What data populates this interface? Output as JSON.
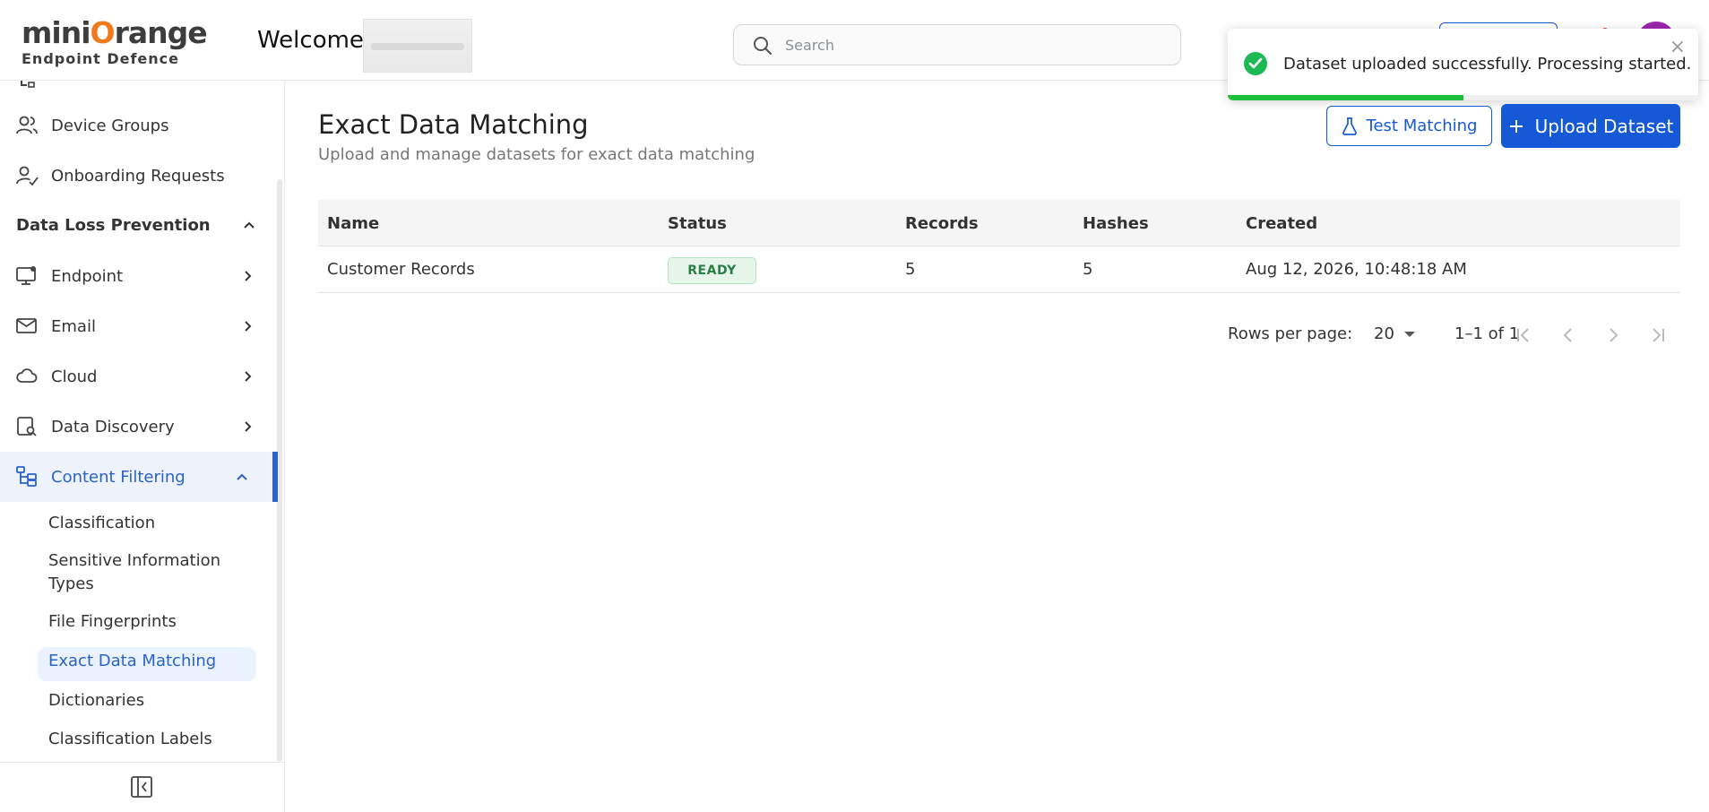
{
  "header": {
    "logo_main_prefix": "mini",
    "logo_main_o": "O",
    "logo_main_suffix": "range",
    "logo_sub": "Endpoint Defence",
    "welcome": "Welcome,",
    "search_placeholder": "Search"
  },
  "toast": {
    "message": "Dataset uploaded successfully. Processing started.",
    "close": "×",
    "progress": 0.5
  },
  "sidebar": {
    "device_groups": "Device Groups",
    "onboarding": "Onboarding Requests",
    "section_dlp": "Data Loss Prevention",
    "endpoint": "Endpoint",
    "email": "Email",
    "cloud": "Cloud",
    "data_discovery": "Data Discovery",
    "content_filtering": "Content Filtering",
    "sub": {
      "classification": "Classification",
      "sit_line1": "Sensitive Information",
      "sit_line2": "Types",
      "file_fingerprints": "File Fingerprints",
      "edm": "Exact Data Matching",
      "dictionaries": "Dictionaries",
      "classification_labels": "Classification Labels"
    }
  },
  "page": {
    "title": "Exact Data Matching",
    "subtitle": "Upload and manage datasets for exact data matching",
    "test_button": "Test Matching",
    "upload_button": "Upload Dataset"
  },
  "table": {
    "headers": [
      "Name",
      "Status",
      "Records",
      "Hashes",
      "Created"
    ],
    "rows": [
      {
        "name": "Customer Records",
        "status": "READY",
        "records": "5",
        "hashes": "5",
        "created": "Aug 12, 2026, 10:48:18 AM"
      }
    ]
  },
  "pagination": {
    "rows_per_page_label": "Rows per page:",
    "rows_per_page_value": "20",
    "range": "1–1 of 1"
  },
  "colors": {
    "accent": "#1559d6",
    "active_nav": "#2a62c9",
    "success": "#1db954",
    "badge_bg": "#e6f6ea"
  }
}
